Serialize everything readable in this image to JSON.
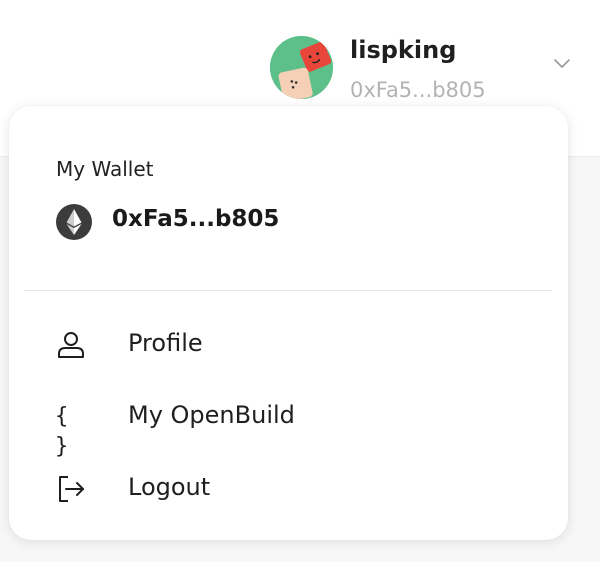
{
  "header": {
    "username": "lispking",
    "address_short": "0xFa5...b805"
  },
  "wallet": {
    "label": "My Wallet",
    "address": "0xFa5...b805",
    "icon": "ethereum-icon"
  },
  "menu": {
    "items": [
      {
        "label": "Profile",
        "icon": "user-icon"
      },
      {
        "label": "My OpenBuild",
        "icon": "braces-icon",
        "glyph": "{ }"
      },
      {
        "label": "Logout",
        "icon": "logout-icon"
      }
    ]
  },
  "colors": {
    "avatar_bg": "#5dc08b",
    "avatar_accent": "#e8463a",
    "secondary_text": "#b3b3b3",
    "eth_icon": "#3c3c3d"
  }
}
